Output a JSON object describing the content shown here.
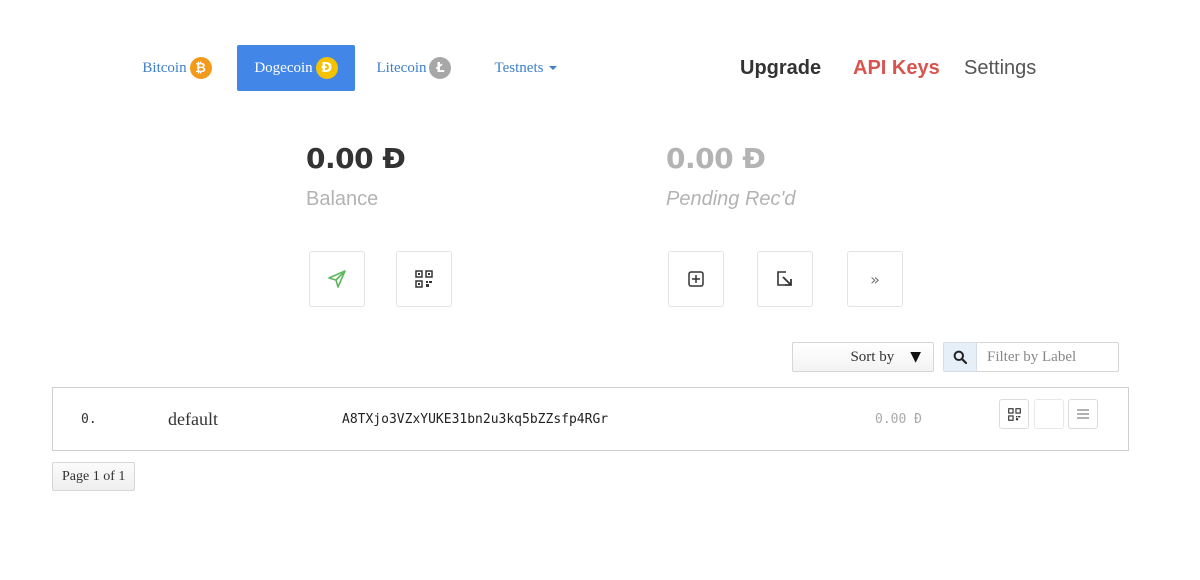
{
  "nav": {
    "tabs": [
      {
        "label": "Bitcoin",
        "icon": "bitcoin-icon",
        "glyph": "₿",
        "active": false
      },
      {
        "label": "Dogecoin",
        "icon": "dogecoin-icon",
        "glyph": "Ð",
        "active": true
      },
      {
        "label": "Litecoin",
        "icon": "litecoin-icon",
        "glyph": "Ł",
        "active": false
      },
      {
        "label": "Testnets",
        "icon": "caret-down-icon",
        "active": false
      }
    ],
    "links": {
      "upgrade": "Upgrade",
      "api_keys": "API Keys",
      "settings": "Settings"
    }
  },
  "balances": {
    "balance_amount": "0.00 Ð",
    "balance_label": "Balance",
    "pending_amount": "0.00 Ð",
    "pending_label": "Pending Rec'd"
  },
  "actions": {
    "left": [
      "send-icon",
      "qr-code-icon"
    ],
    "right": [
      "add-address-icon",
      "import-icon",
      "double-chevron-right-icon"
    ],
    "double_chevron_glyph": "»"
  },
  "toolbar": {
    "sort_label": "Sort by",
    "sort_arrow": "▼",
    "filter_placeholder": "Filter by Label"
  },
  "addresses": [
    {
      "index": "0.",
      "label": "default",
      "address": "A8TXjo3VZxYUKE31bn2u3kq5bZZsfp4RGr",
      "balance": "0.00 Ð"
    }
  ],
  "pagination": {
    "text": "Page 1 of 1"
  },
  "colors": {
    "active_tab": "#4286e8",
    "link_blue": "#3f80c9",
    "api_keys_red": "#d9534f",
    "muted_gray": "#b3b3b3",
    "send_green": "#5cb85c"
  }
}
